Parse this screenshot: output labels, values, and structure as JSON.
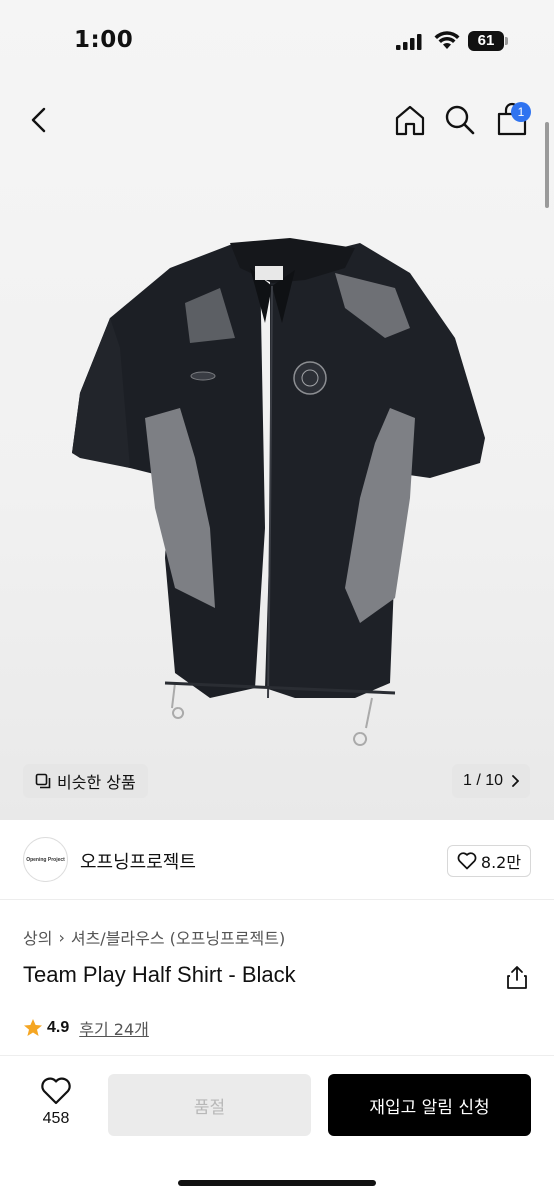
{
  "status_bar": {
    "time": "1:00",
    "battery": "61"
  },
  "nav": {
    "cart_count": "1"
  },
  "gallery": {
    "similar_label": "비슷한 상품",
    "counter": "1 / 10"
  },
  "brand": {
    "name": "오프닝프로젝트",
    "logo_text": "Opening Project",
    "likes": "8.2만"
  },
  "product": {
    "breadcrumb": [
      "상의",
      "셔츠/블라우스 (오프닝프로젝트)"
    ],
    "title": "Team Play Half Shirt - Black",
    "rating": "4.9",
    "reviews": "후기 24개"
  },
  "bottom": {
    "wish_count": "458",
    "soldout_label": "품절",
    "restock_label": "재입고 알림 신청"
  },
  "colors": {
    "badge": "#2f73f0",
    "star": "#f5a623",
    "primary_button": "#000000",
    "disabled_button": "#ebebeb"
  }
}
